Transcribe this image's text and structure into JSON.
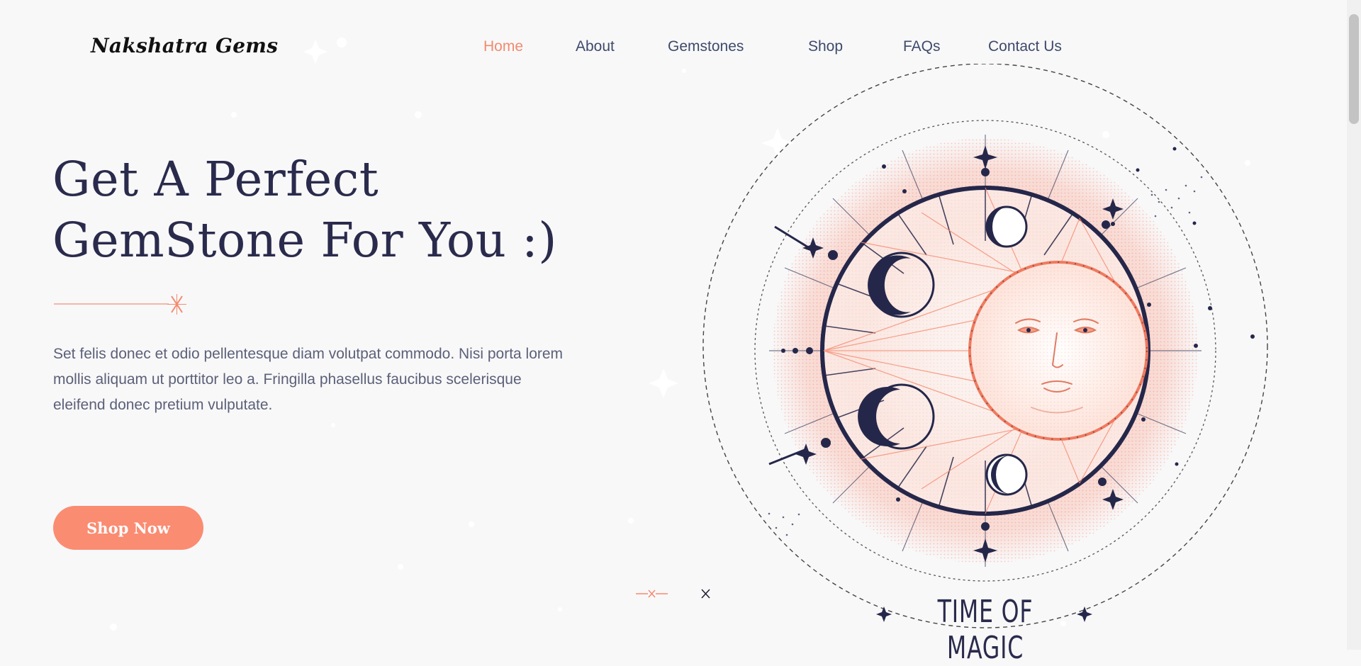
{
  "brand": {
    "name": "Nakshatra Gems"
  },
  "nav": {
    "items": [
      {
        "label": "Home",
        "active": true
      },
      {
        "label": "About",
        "active": false
      },
      {
        "label": "Gemstones",
        "active": false
      },
      {
        "label": "Shop",
        "active": false
      },
      {
        "label": "FAQs",
        "active": false
      },
      {
        "label": "Contact Us",
        "active": false
      }
    ]
  },
  "hero": {
    "title_line1": "Get A Perfect",
    "title_line2": "GemStone For You :)",
    "description": "Set felis donec et odio pellentesque diam volutpat commodo. Nisi porta lorem mollis aliquam ut porttitor leo a. Fringilla phasellus faucibus scelerisque eleifend donec pretium vulputate.",
    "cta_label": "Shop Now"
  },
  "emblem": {
    "caption": "TIME OF MAGIC"
  },
  "colors": {
    "accent": "#fa8c72",
    "nav_active": "#f28b6e",
    "heading": "#2a2b4c",
    "body_text": "#5c6078",
    "navy": "#25274a"
  },
  "icons": {
    "divider": "sparkle-cross-icon",
    "slider_prev": "slider-dot-active-icon",
    "slider_next": "slider-dot-icon"
  }
}
